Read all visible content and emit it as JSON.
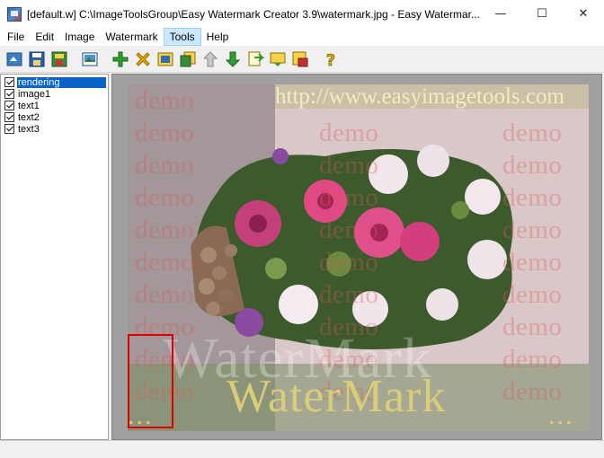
{
  "window": {
    "title": "[default.w] C:\\ImageToolsGroup\\Easy Watermark Creator 3.9\\watermark.jpg - Easy Watermar...",
    "minimize_glyph": "—",
    "maximize_glyph": "☐",
    "close_glyph": "✕"
  },
  "menu": {
    "items": [
      {
        "label": "File"
      },
      {
        "label": "Edit"
      },
      {
        "label": "Image"
      },
      {
        "label": "Watermark"
      },
      {
        "label": "Tools"
      },
      {
        "label": "Help"
      }
    ],
    "active": "Tools"
  },
  "toolbar": {
    "buttons": [
      {
        "icon": "open-icon",
        "color": "#3a7fc4"
      },
      {
        "icon": "save-icon",
        "color": "#2a5fa8"
      },
      {
        "icon": "save-as-icon",
        "color": "#3b8a3a"
      },
      {
        "icon": "image-icon",
        "color": "#2e6db0"
      },
      {
        "icon": "add-icon",
        "color": "#2f9e2f"
      },
      {
        "icon": "delete-icon",
        "color": "#e0a000"
      },
      {
        "icon": "text-icon",
        "color": "#2e6db0"
      },
      {
        "icon": "duplicate-icon",
        "color": "#3b8a3a"
      },
      {
        "icon": "move-up-icon",
        "color": "#9a9a9a"
      },
      {
        "icon": "move-down-icon",
        "color": "#2f9e2f"
      },
      {
        "icon": "export-icon",
        "color": "#d9a000"
      },
      {
        "icon": "batch-icon",
        "color": "#d9a000"
      },
      {
        "icon": "save-project-icon",
        "color": "#c03030"
      },
      {
        "icon": "help-icon",
        "color": "#c8a000"
      }
    ]
  },
  "tree": {
    "items": [
      {
        "label": "rendering",
        "checked": true,
        "selected": true
      },
      {
        "label": "image1",
        "checked": true
      },
      {
        "label": "text1",
        "checked": true
      },
      {
        "label": "text2",
        "checked": true
      },
      {
        "label": "text3",
        "checked": true
      }
    ]
  },
  "preview": {
    "url_text": "http://www.easyimagetools.com",
    "demo_text": "demo",
    "watermark_large": "WaterMark",
    "watermark_small": "WaterMark",
    "dots": "...",
    "colors": {
      "demo": "#dc5a5a",
      "watermark_gold": "#d9cc7a",
      "selection": "#e00000"
    }
  }
}
